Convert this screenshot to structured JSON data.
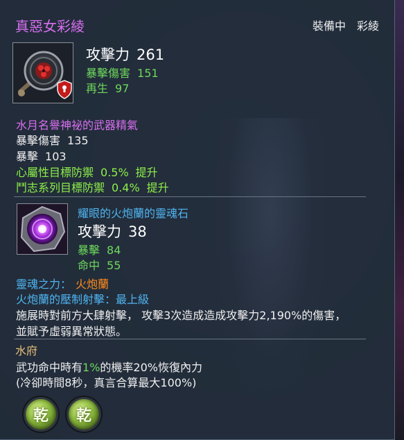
{
  "title": "真惡女彩綾",
  "equip_status": {
    "state": "裝備中",
    "name": "彩綾"
  },
  "weapon": {
    "icon": "weapon-medallion-icon",
    "attack_label": "攻擊力",
    "attack_value": "261",
    "stats": [
      {
        "label": "暴擊傷害",
        "value": "151"
      },
      {
        "label": "再生",
        "value": "97"
      }
    ]
  },
  "essence": {
    "title": "水月名譽神祕的武器精氣",
    "stats": [
      {
        "label": "暴擊傷害",
        "value": "135"
      },
      {
        "label": "暴擊",
        "value": "103"
      }
    ],
    "bonuses": [
      {
        "label": "心屬性目標防禦",
        "value": "0.5%",
        "suffix": "提升"
      },
      {
        "label": "鬥志系列目標防禦",
        "value": "0.4%",
        "suffix": "提升"
      }
    ]
  },
  "soul": {
    "icon": "soul-stone-icon",
    "title": "耀眼的火炮蘭的靈魂石",
    "attack_label": "攻擊力",
    "attack_value": "38",
    "stats": [
      {
        "label": "暴擊",
        "value": "84"
      },
      {
        "label": "命中",
        "value": "55"
      }
    ],
    "power_label": "靈魂之力：",
    "power_value": "火炮蘭",
    "skill": "火炮蘭的壓制射擊：最上級",
    "desc_line1": "施展時對前方大肆射擊，  攻擊3次造成造成攻擊力2,190%的傷害，",
    "desc_line2": "並賦予虛弱異常狀態。"
  },
  "set_effect": {
    "title": "水府",
    "line1_a": "武功命中時有",
    "line1_pct": "1%",
    "line1_b": "的機率20%恢復內力",
    "line2": "(冷卻時間8秒，真言合算最大100%)"
  },
  "slots": [
    {
      "glyph": "乾",
      "icon": "qian-gem-icon"
    },
    {
      "glyph": "乾",
      "icon": "qian-gem-icon"
    }
  ],
  "colors": {
    "title": "#d86ef0",
    "stat_green": "#6ed85c",
    "bonus_lime": "#8ef04a",
    "soul_blue": "#4fb4f0",
    "soul_power_orange": "#ff8a1e",
    "section_gold": "#e8c07a"
  }
}
